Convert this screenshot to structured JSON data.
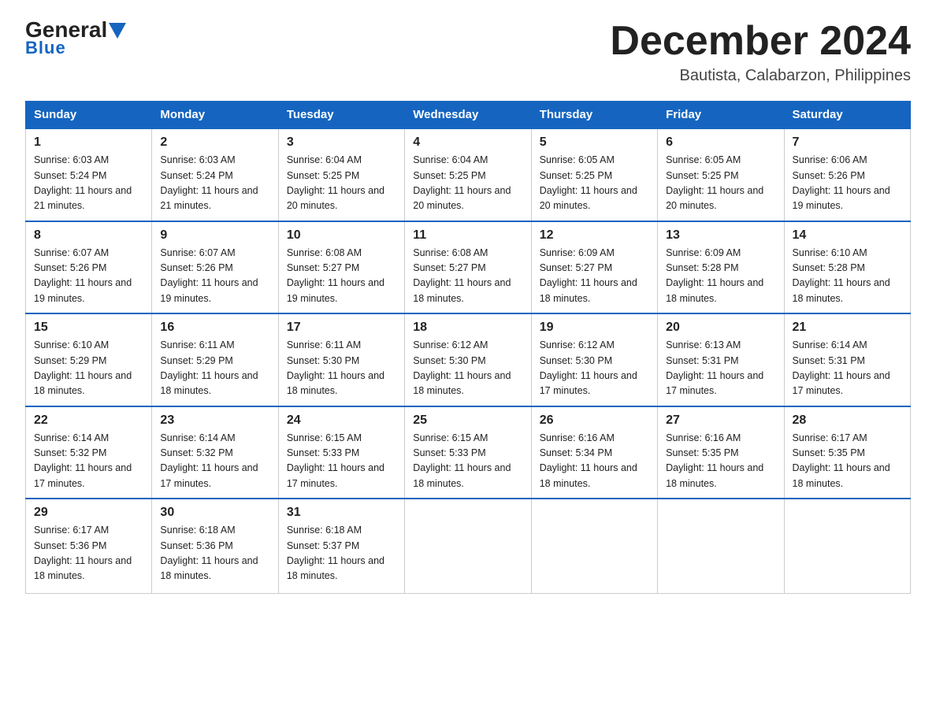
{
  "header": {
    "logo_general": "General",
    "logo_blue": "Blue",
    "month_title": "December 2024",
    "location": "Bautista, Calabarzon, Philippines"
  },
  "days_of_week": [
    "Sunday",
    "Monday",
    "Tuesday",
    "Wednesday",
    "Thursday",
    "Friday",
    "Saturday"
  ],
  "weeks": [
    [
      {
        "day": "1",
        "sunrise": "6:03 AM",
        "sunset": "5:24 PM",
        "daylight": "11 hours and 21 minutes."
      },
      {
        "day": "2",
        "sunrise": "6:03 AM",
        "sunset": "5:24 PM",
        "daylight": "11 hours and 21 minutes."
      },
      {
        "day": "3",
        "sunrise": "6:04 AM",
        "sunset": "5:25 PM",
        "daylight": "11 hours and 20 minutes."
      },
      {
        "day": "4",
        "sunrise": "6:04 AM",
        "sunset": "5:25 PM",
        "daylight": "11 hours and 20 minutes."
      },
      {
        "day": "5",
        "sunrise": "6:05 AM",
        "sunset": "5:25 PM",
        "daylight": "11 hours and 20 minutes."
      },
      {
        "day": "6",
        "sunrise": "6:05 AM",
        "sunset": "5:25 PM",
        "daylight": "11 hours and 20 minutes."
      },
      {
        "day": "7",
        "sunrise": "6:06 AM",
        "sunset": "5:26 PM",
        "daylight": "11 hours and 19 minutes."
      }
    ],
    [
      {
        "day": "8",
        "sunrise": "6:07 AM",
        "sunset": "5:26 PM",
        "daylight": "11 hours and 19 minutes."
      },
      {
        "day": "9",
        "sunrise": "6:07 AM",
        "sunset": "5:26 PM",
        "daylight": "11 hours and 19 minutes."
      },
      {
        "day": "10",
        "sunrise": "6:08 AM",
        "sunset": "5:27 PM",
        "daylight": "11 hours and 19 minutes."
      },
      {
        "day": "11",
        "sunrise": "6:08 AM",
        "sunset": "5:27 PM",
        "daylight": "11 hours and 18 minutes."
      },
      {
        "day": "12",
        "sunrise": "6:09 AM",
        "sunset": "5:27 PM",
        "daylight": "11 hours and 18 minutes."
      },
      {
        "day": "13",
        "sunrise": "6:09 AM",
        "sunset": "5:28 PM",
        "daylight": "11 hours and 18 minutes."
      },
      {
        "day": "14",
        "sunrise": "6:10 AM",
        "sunset": "5:28 PM",
        "daylight": "11 hours and 18 minutes."
      }
    ],
    [
      {
        "day": "15",
        "sunrise": "6:10 AM",
        "sunset": "5:29 PM",
        "daylight": "11 hours and 18 minutes."
      },
      {
        "day": "16",
        "sunrise": "6:11 AM",
        "sunset": "5:29 PM",
        "daylight": "11 hours and 18 minutes."
      },
      {
        "day": "17",
        "sunrise": "6:11 AM",
        "sunset": "5:30 PM",
        "daylight": "11 hours and 18 minutes."
      },
      {
        "day": "18",
        "sunrise": "6:12 AM",
        "sunset": "5:30 PM",
        "daylight": "11 hours and 18 minutes."
      },
      {
        "day": "19",
        "sunrise": "6:12 AM",
        "sunset": "5:30 PM",
        "daylight": "11 hours and 17 minutes."
      },
      {
        "day": "20",
        "sunrise": "6:13 AM",
        "sunset": "5:31 PM",
        "daylight": "11 hours and 17 minutes."
      },
      {
        "day": "21",
        "sunrise": "6:14 AM",
        "sunset": "5:31 PM",
        "daylight": "11 hours and 17 minutes."
      }
    ],
    [
      {
        "day": "22",
        "sunrise": "6:14 AM",
        "sunset": "5:32 PM",
        "daylight": "11 hours and 17 minutes."
      },
      {
        "day": "23",
        "sunrise": "6:14 AM",
        "sunset": "5:32 PM",
        "daylight": "11 hours and 17 minutes."
      },
      {
        "day": "24",
        "sunrise": "6:15 AM",
        "sunset": "5:33 PM",
        "daylight": "11 hours and 17 minutes."
      },
      {
        "day": "25",
        "sunrise": "6:15 AM",
        "sunset": "5:33 PM",
        "daylight": "11 hours and 18 minutes."
      },
      {
        "day": "26",
        "sunrise": "6:16 AM",
        "sunset": "5:34 PM",
        "daylight": "11 hours and 18 minutes."
      },
      {
        "day": "27",
        "sunrise": "6:16 AM",
        "sunset": "5:35 PM",
        "daylight": "11 hours and 18 minutes."
      },
      {
        "day": "28",
        "sunrise": "6:17 AM",
        "sunset": "5:35 PM",
        "daylight": "11 hours and 18 minutes."
      }
    ],
    [
      {
        "day": "29",
        "sunrise": "6:17 AM",
        "sunset": "5:36 PM",
        "daylight": "11 hours and 18 minutes."
      },
      {
        "day": "30",
        "sunrise": "6:18 AM",
        "sunset": "5:36 PM",
        "daylight": "11 hours and 18 minutes."
      },
      {
        "day": "31",
        "sunrise": "6:18 AM",
        "sunset": "5:37 PM",
        "daylight": "11 hours and 18 minutes."
      },
      null,
      null,
      null,
      null
    ]
  ],
  "labels": {
    "sunrise": "Sunrise:",
    "sunset": "Sunset:",
    "daylight": "Daylight:"
  }
}
